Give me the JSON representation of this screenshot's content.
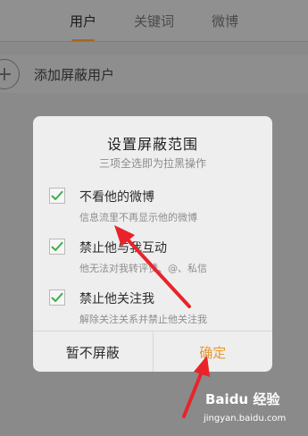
{
  "tabs": [
    {
      "label": "用户",
      "active": true
    },
    {
      "label": "关键词",
      "active": false
    },
    {
      "label": "微博",
      "active": false
    }
  ],
  "add_row": {
    "label": "添加屏蔽用户",
    "icon": "plus-icon"
  },
  "dialog": {
    "title": "设置屏蔽范围",
    "subtitle": "三项全选即为拉黑操作",
    "options": [
      {
        "title": "不看他的微博",
        "desc": "信息流里不再显示他的微博",
        "checked": true
      },
      {
        "title": "禁止他与我互动",
        "desc": "他无法对我转评赞、@、私信",
        "checked": true
      },
      {
        "title": "禁止他关注我",
        "desc": "解除关注关系并禁止他关注我",
        "checked": true
      }
    ],
    "cancel_label": "暂不屏蔽",
    "confirm_label": "确定"
  },
  "watermark": {
    "logo": "Baidu 经验",
    "url": "jingyan.baidu.com"
  },
  "colors": {
    "accent": "#e69a2e",
    "check": "#3fae49",
    "arrow": "#e8242a"
  }
}
